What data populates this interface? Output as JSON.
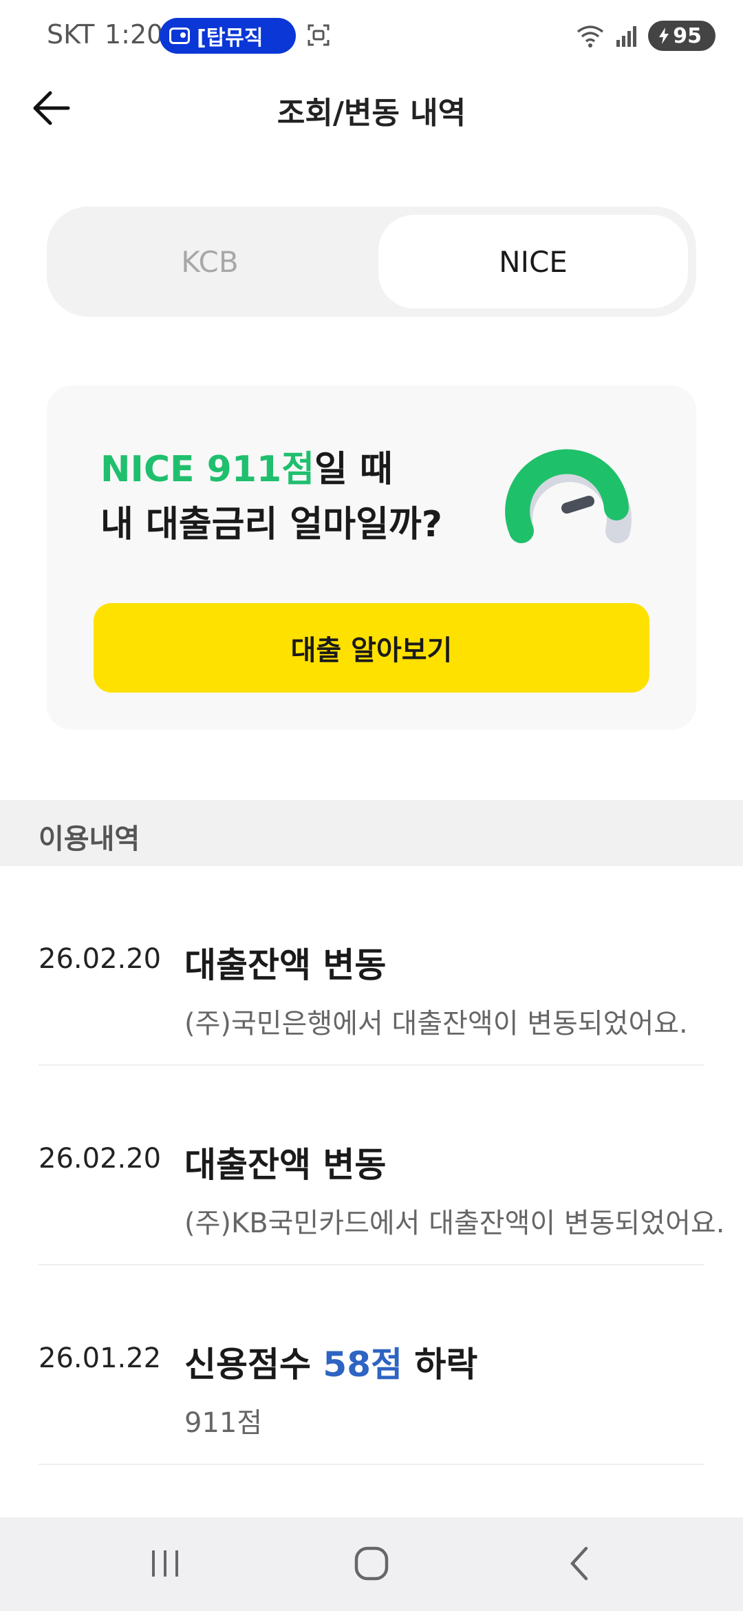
{
  "status_bar": {
    "carrier": "SKT",
    "time": "1:20",
    "media_pill": "[탑뮤직",
    "battery": "95"
  },
  "header": {
    "title": "조회/변동 내역"
  },
  "tabs": [
    {
      "label": "KCB",
      "selected": false
    },
    {
      "label": "NICE",
      "selected": true
    }
  ],
  "promo": {
    "line1_highlight": "NICE 911점",
    "line1_rest": "일 때",
    "line2": "내 대출금리 얼마일까?",
    "button_label": "대출 알아보기"
  },
  "section": {
    "title": "이용내역"
  },
  "history": [
    {
      "date": "26.02.20",
      "title": "대출잔액 변동",
      "desc": "(주)국민은행에서 대출잔액이 변동되었어요."
    },
    {
      "date": "26.02.20",
      "title": "대출잔액 변동",
      "desc": "(주)KB국민카드에서 대출잔액이 변동되었어요."
    },
    {
      "date": "26.01.22",
      "title_prefix": "신용점수 ",
      "title_highlight": "58점",
      "title_suffix": " 하락",
      "desc": "911점"
    }
  ],
  "colors": {
    "accent_yellow": "#ffe100",
    "score_green": "#1fbf6e",
    "highlight_blue": "#2e64c2",
    "media_pill_blue": "#0a37d6"
  },
  "nav_icons": [
    "recent-apps-icon",
    "home-icon",
    "back-icon"
  ]
}
